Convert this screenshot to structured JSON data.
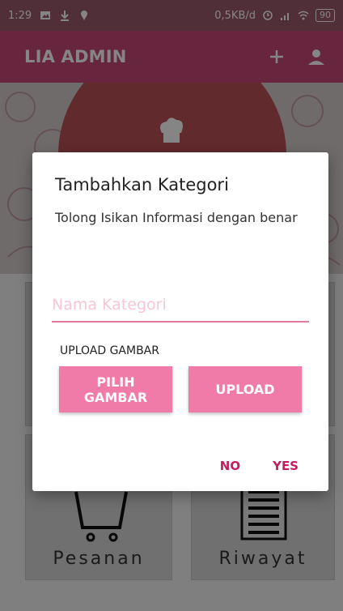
{
  "status_bar": {
    "time": "1:29",
    "network_speed": "0,5KB/d",
    "battery": "90",
    "icons": [
      "image-icon",
      "download-icon",
      "location-icon",
      "alarm-icon",
      "signal-icon",
      "wifi-icon"
    ]
  },
  "app_bar": {
    "title": "LIA ADMIN",
    "actions": [
      "add-icon",
      "person-icon"
    ]
  },
  "background_cards": [
    {
      "label": "Pesanan",
      "icon": "cart-icon"
    },
    {
      "label": "Riwayat",
      "icon": "document-icon"
    }
  ],
  "dialog": {
    "title": "Tambahkan Kategori",
    "message": "Tolong Isikan Informasi dengan benar",
    "category_input": {
      "value": "",
      "placeholder": "Nama Kategori"
    },
    "upload_label": "UPLOAD GAMBAR",
    "pick_image_button": "PILIH GAMBAR",
    "upload_button": "UPLOAD",
    "no_button": "NO",
    "yes_button": "YES"
  },
  "colors": {
    "primary": "#c54a78",
    "accent": "#f07aa8",
    "dialog_action": "#c41c60"
  }
}
